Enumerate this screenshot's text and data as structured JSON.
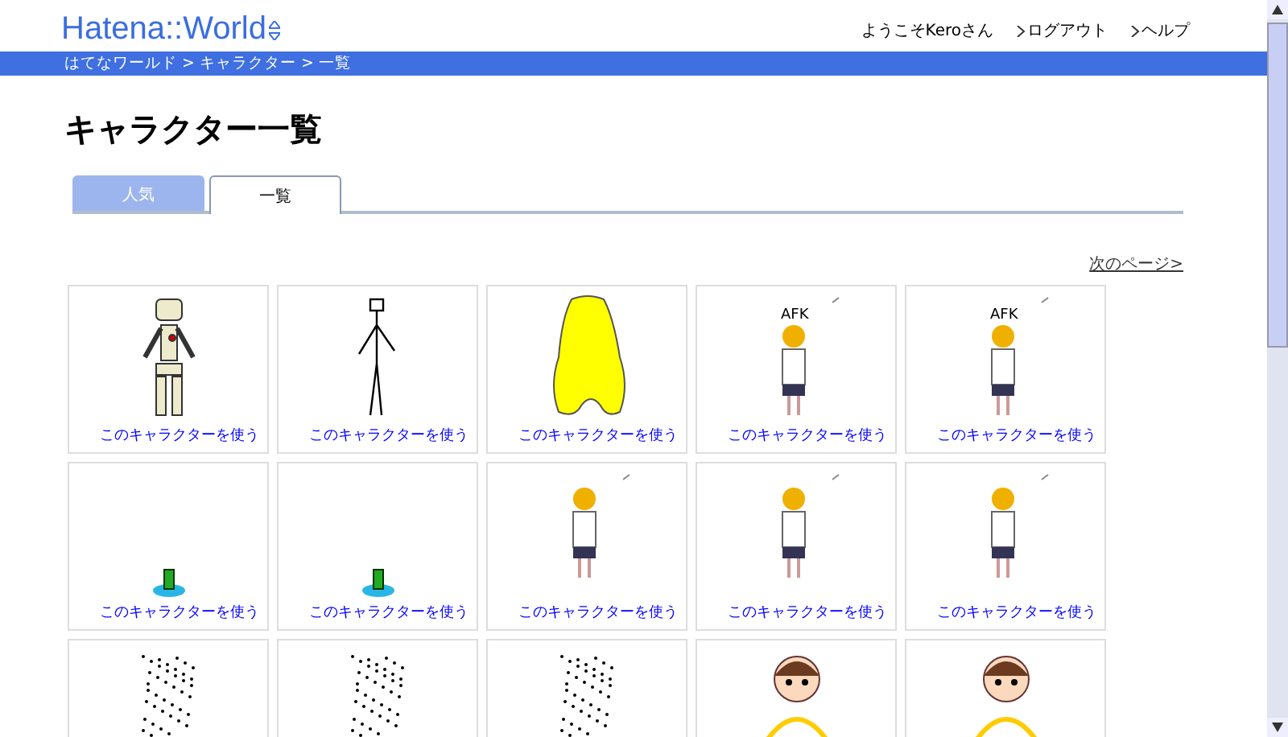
{
  "header": {
    "logo": "Hatena::World",
    "user_links": [
      {
        "label": "ようこそKeroさん",
        "arrow": false
      },
      {
        "label": "ログアウト",
        "arrow": true
      },
      {
        "label": "ヘルプ",
        "arrow": true
      }
    ]
  },
  "breadcrumb": "はてなワールド > キャラクター > 一覧",
  "title": "キャラクター一覧",
  "tabs": [
    {
      "label": "人気",
      "selected": false
    },
    {
      "label": "一覧",
      "selected": true
    }
  ],
  "next_page": "次のページ>",
  "cards": [
    {
      "kind": "skeleton",
      "link": "このキャラクターを使う"
    },
    {
      "kind": "stickman",
      "link": "このキャラクターを使う"
    },
    {
      "kind": "blob",
      "link": "このキャラクターを使う"
    },
    {
      "kind": "girl",
      "caption": "AFK",
      "link": "このキャラクターを使う"
    },
    {
      "kind": "girl",
      "caption": "AFK",
      "link": "このキャラクターを使う"
    },
    {
      "kind": "bottle",
      "link": "このキャラクターを使う"
    },
    {
      "kind": "bottle",
      "link": "このキャラクターを使う"
    },
    {
      "kind": "girl",
      "link": "このキャラクターを使う"
    },
    {
      "kind": "girl",
      "link": "このキャラクターを使う"
    },
    {
      "kind": "girl",
      "link": "このキャラクターを使う"
    },
    {
      "kind": "dots"
    },
    {
      "kind": "dots"
    },
    {
      "kind": "dots"
    },
    {
      "kind": "kid"
    },
    {
      "kind": "kid"
    }
  ]
}
